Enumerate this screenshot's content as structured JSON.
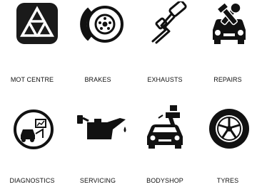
{
  "services": [
    {
      "label": "MOT CENTRE",
      "icon": "mot-triangles-icon"
    },
    {
      "label": "BRAKES",
      "icon": "brake-disc-icon"
    },
    {
      "label": "EXHAUSTS",
      "icon": "exhaust-pipe-icon"
    },
    {
      "label": "REPAIRS",
      "icon": "car-repair-icon"
    },
    {
      "label": "DIAGNOSTICS",
      "icon": "diagnostics-gauge-icon"
    },
    {
      "label": "SERVICING",
      "icon": "oil-can-icon"
    },
    {
      "label": "BODYSHOP",
      "icon": "spray-gun-car-icon"
    },
    {
      "label": "TYRES",
      "icon": "tyre-icon"
    }
  ],
  "colors": {
    "icon": "#111111",
    "background": "#ffffff"
  }
}
